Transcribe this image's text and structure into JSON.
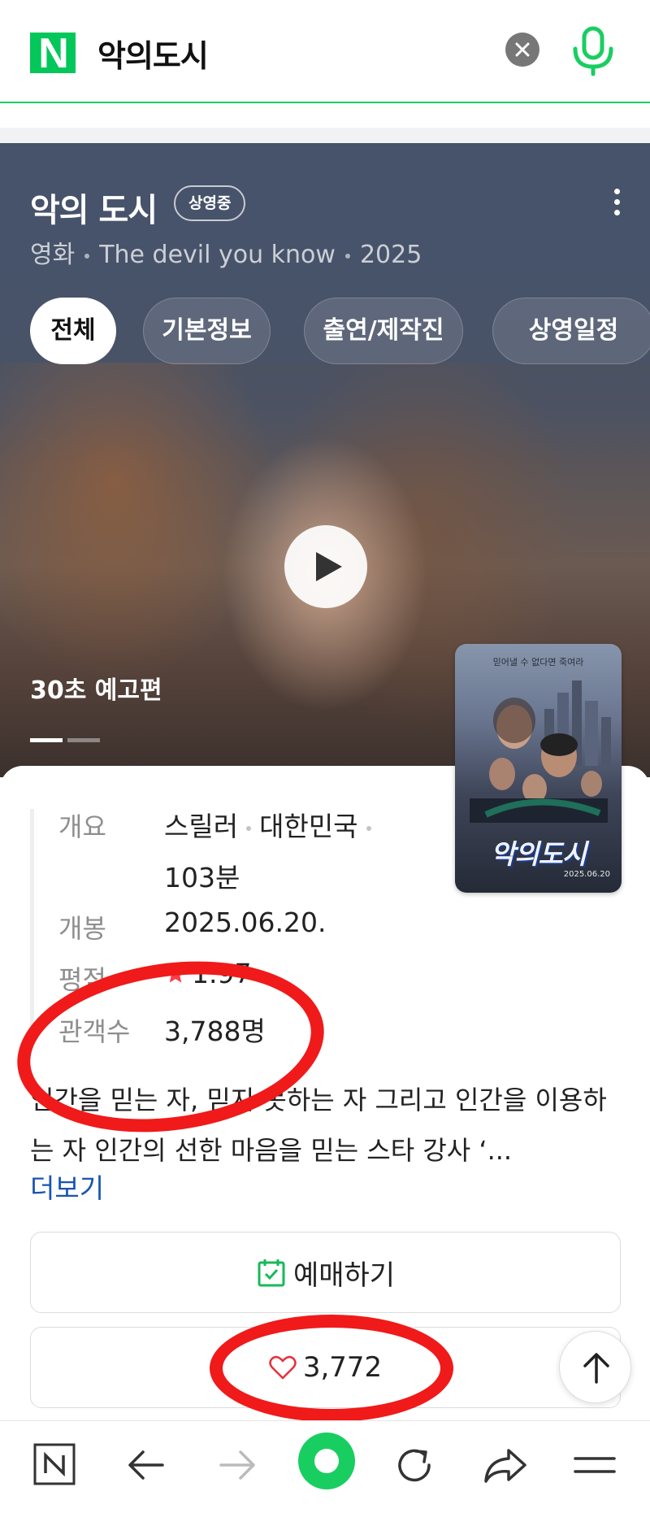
{
  "search": {
    "logo": "N",
    "query": "악의도시"
  },
  "movie": {
    "title": "악의 도시",
    "status_badge": "상영중",
    "subtitle": {
      "category": "영화",
      "english_title": "The devil you know",
      "year": "2025"
    },
    "tabs": [
      {
        "label": "전체",
        "active": true
      },
      {
        "label": "기본정보",
        "active": false
      },
      {
        "label": "출연/제작진",
        "active": false
      },
      {
        "label": "상영일정",
        "active": false
      }
    ],
    "trailer_label": "30초 예고편",
    "poster": {
      "tagline": "믿어낼 수 없다면 죽여라",
      "title": "악의도시",
      "date": "2025.06.20"
    }
  },
  "info": {
    "overview_label": "개요",
    "overview_genre": "스릴러",
    "overview_country": "대한민국",
    "overview_runtime": "103분",
    "release_label": "개봉",
    "release_date": "2025.06.20.",
    "rating_label": "평점",
    "rating_value": "1.97",
    "audience_label": "관객수",
    "audience_value": "3,788명",
    "synopsis": "인간을 믿는 자, 믿지 못하는 자 그리고 인간을 이용하는 자 인간의 선한 마음을 믿는 스타 강사 ‘...",
    "more_link": "더보기"
  },
  "actions": {
    "book_label": "예매하기",
    "like_count": "3,772"
  },
  "colors": {
    "naver_green": "#03c75a",
    "annotation_red": "#f01a1a",
    "link_blue": "#1a55b0"
  },
  "icons": [
    "naver-logo-icon",
    "clear-icon",
    "mic-icon",
    "more-vertical-icon",
    "play-icon",
    "star-icon",
    "calendar-check-icon",
    "heart-icon",
    "arrow-up-icon",
    "naver-home-icon",
    "back-arrow-icon",
    "forward-arrow-icon",
    "green-dot-icon",
    "refresh-icon",
    "share-icon",
    "menu-icon"
  ]
}
